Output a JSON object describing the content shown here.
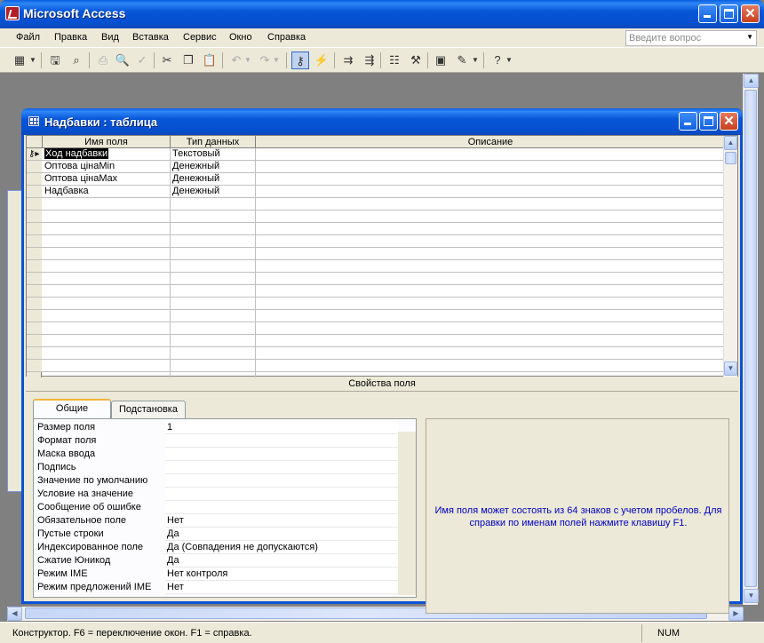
{
  "app": {
    "title": "Microsoft Access"
  },
  "menu": {
    "items": [
      "Файл",
      "Правка",
      "Вид",
      "Вставка",
      "Сервис",
      "Окно",
      "Справка"
    ],
    "help_placeholder": "Введите вопрос"
  },
  "toolbar": {
    "icons": [
      "view-icon",
      "save-icon",
      "search-file-icon",
      "print-icon",
      "preview-icon",
      "spell-icon",
      "cut-icon",
      "copy-icon",
      "paste-icon",
      "undo-icon",
      "redo-icon",
      "primary-key-icon",
      "indexes-icon",
      "insert-rows-icon",
      "delete-rows-icon",
      "properties-icon",
      "build-icon",
      "database-window-icon",
      "new-object-icon",
      "help-icon"
    ]
  },
  "child": {
    "title": "Надбавки : таблица"
  },
  "grid": {
    "headers": [
      "Имя поля",
      "Тип данных",
      "Описание"
    ],
    "rows": [
      {
        "name": "Ход надбавки",
        "type": "Текстовый",
        "desc": "",
        "key": true
      },
      {
        "name": "Оптова цінаMin",
        "type": "Денежный",
        "desc": ""
      },
      {
        "name": "Оптова цінаMax",
        "type": "Денежный",
        "desc": ""
      },
      {
        "name": "Надбавка",
        "type": "Денежный",
        "desc": ""
      }
    ]
  },
  "properties": {
    "section_label": "Свойства поля",
    "tabs": [
      "Общие",
      "Подстановка"
    ],
    "rows": [
      {
        "label": "Размер поля",
        "value": "1"
      },
      {
        "label": "Формат поля",
        "value": ""
      },
      {
        "label": "Маска ввода",
        "value": ""
      },
      {
        "label": "Подпись",
        "value": ""
      },
      {
        "label": "Значение по умолчанию",
        "value": ""
      },
      {
        "label": "Условие на значение",
        "value": ""
      },
      {
        "label": "Сообщение об ошибке",
        "value": ""
      },
      {
        "label": "Обязательное поле",
        "value": "Нет"
      },
      {
        "label": "Пустые строки",
        "value": "Да"
      },
      {
        "label": "Индексированное поле",
        "value": "Да (Совпадения не допускаются)"
      },
      {
        "label": "Сжатие Юникод",
        "value": "Да"
      },
      {
        "label": "Режим IME",
        "value": "Нет контроля"
      },
      {
        "label": "Режим предложений IME",
        "value": "Нет"
      }
    ],
    "help_text": "Имя поля может состоять из 64 знаков с учетом пробелов.  Для справки по именам полей нажмите клавишу F1.",
    "help_color": "#0000c0"
  },
  "status": {
    "text": "Конструктор.  F6 = переключение окон.  F1 = справка.",
    "num": "NUM"
  }
}
